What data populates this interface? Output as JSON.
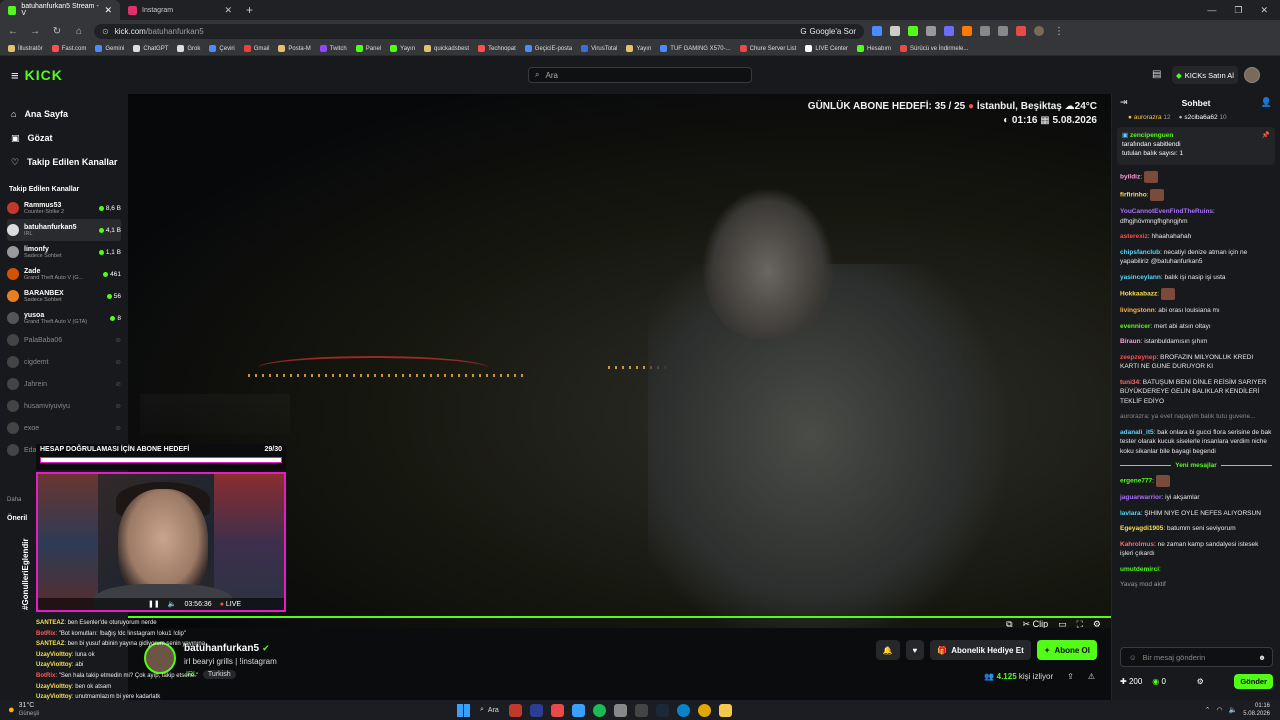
{
  "browser": {
    "tabs": [
      {
        "label": "batuhanfurkan5 Stream - V",
        "active": true,
        "color": "#53fc18"
      },
      {
        "label": "Instagram",
        "active": false,
        "color": "#e1306c"
      }
    ],
    "url_host": "kick.com",
    "url_path": "/batuhanfurkan5",
    "google_sor": "Google'a Sor",
    "bookmarks": [
      "İllustratör",
      "Fast.com",
      "Gemini",
      "ChatGPT",
      "Grok",
      "Çeviri",
      "Gmail",
      "Posta-M",
      "Twitch",
      "Panel",
      "Yayın",
      "quickadsbest",
      "Technopat",
      "GeçiciE-posta",
      "VirusTotal",
      "Yayın",
      "TUF GAMING X570-...",
      "Chure Server List",
      "LIVE Center",
      "Hesabım",
      "Sürücü ve İndirmele..."
    ]
  },
  "header": {
    "logo": "KICK",
    "search_placeholder": "Ara",
    "buy_kicks": "KICKs Satın Al"
  },
  "sidebar": {
    "nav": [
      {
        "label": "Ana Sayfa",
        "icon": "home-icon"
      },
      {
        "label": "Gözat",
        "icon": "browse-icon"
      },
      {
        "label": "Takip Edilen Kanallar",
        "icon": "heart-icon"
      }
    ],
    "section_title": "Takip Edilen Kanallar",
    "channels": [
      {
        "name": "Rammus53",
        "sub": "Counter-Strike 2",
        "viewers": "8,6 B",
        "live": true
      },
      {
        "name": "batuhanfurkan5",
        "sub": "IRL",
        "viewers": "4,1 B",
        "live": true,
        "selected": true
      },
      {
        "name": "limonfy",
        "sub": "Sadece Sohbet",
        "viewers": "1,1 B",
        "live": true
      },
      {
        "name": "Zade",
        "sub": "Grand Theft Auto V (G...",
        "viewers": "461",
        "live": true
      },
      {
        "name": "BARANBEX",
        "sub": "Sadece Sohbet",
        "viewers": "56",
        "live": true
      },
      {
        "name": "yusoa",
        "sub": "Grand Theft Auto V (GTA)",
        "viewers": "8",
        "live": true
      },
      {
        "name": "PalaBaba06",
        "live": false
      },
      {
        "name": "cigdemt",
        "live": false
      },
      {
        "name": "Jahrein",
        "live": false
      },
      {
        "name": "husamviyuviyu",
        "live": false
      },
      {
        "name": "exoe",
        "live": false
      },
      {
        "name": "EdaVera",
        "live": false
      }
    ],
    "more": "Daha",
    "suggested": "Öneril"
  },
  "video": {
    "goal_line1": "GÜNLÜK ABONE HEDEFİ: 35 / 25",
    "location": "İstanbul, Beşiktaş",
    "temp": "24°C",
    "time": "01:16",
    "date": "5.08.2026",
    "sub_goal_title": "HESAP DOĞRULAMASI İÇİN ABONE HEDEFİ",
    "sub_goal_count": "29/30",
    "sub_goal_progress": 0.97,
    "vertical_label": "#GonulleriEglendir",
    "elapsed": "03:56:36",
    "live_label": "LIVE",
    "clip_label": "Clip",
    "progress": 1.0
  },
  "overlay_chat": [
    {
      "user": "SANTEAZ",
      "text": "ben Esenler'de oturuyorum nerde",
      "cls": "u"
    },
    {
      "user": "BotRix",
      "text": "\"Bot komutları: !bağış !dc !instagram !oku1 !clip\"",
      "cls": "u2"
    },
    {
      "user": "SANTEAZ",
      "text": "ben bi yusuf abinin yayına gidiyorum senin yayınına",
      "cls": "u"
    },
    {
      "user": "UzayViolttoy",
      "text": "luna ok",
      "cls": "u"
    },
    {
      "user": "UzayViolttoy",
      "text": "abi",
      "cls": "u"
    },
    {
      "user": "BotRix",
      "text": "\"Sen hala takip etmedin mi? Çok ayıp, takip etsene.\"",
      "cls": "u2"
    },
    {
      "user": "UzayViolttoy",
      "text": "ben ok atsam",
      "cls": "u"
    },
    {
      "user": "UzayViolttoy",
      "text": "unutmamlazım bi yere kadarlatk",
      "cls": "u"
    }
  ],
  "streamer": {
    "name": "batuhanfurkan5",
    "title": "irl bearyi grills | !instagram",
    "tags": [
      "IRL",
      "Turkish"
    ],
    "gift_sub": "Abonelik Hediye Et",
    "subscribe": "Abone Ol",
    "viewers": "4.125",
    "viewers_label": "kişi izliyor"
  },
  "chat": {
    "title": "Sohbet",
    "leaders": [
      {
        "name": "aurorazra",
        "n": "12"
      },
      {
        "name": "s2ciba6a62",
        "n": "10"
      }
    ],
    "pinned_user": "zencipenguen",
    "pinned_by": "tarafından sabitlendi",
    "pinned_text": "tutulan balık sayısı: 1",
    "messages": [
      {
        "user": "byildiz",
        "text": "",
        "color": "#ff9cd6",
        "emote": true
      },
      {
        "user": "firfirinho",
        "text": "",
        "color": "#f4e04d",
        "emote": true
      },
      {
        "user": "YouCannotEvenFindTheRuins",
        "text": "dfhgjhövmngfhghngjhm",
        "color": "#a970ff"
      },
      {
        "user": "asterexiz",
        "text": "hhaahahahah",
        "color": "#ff4d4d"
      },
      {
        "user": "chipsfanclub",
        "text": "necatiyi denize atman için ne yapabiliriz @batuhanfurkan5",
        "color": "#53d8fb"
      },
      {
        "user": "yasinceylann",
        "text": "balık işi nasip işi usta",
        "color": "#53d8fb"
      },
      {
        "user": "Hokkaabazz",
        "text": "",
        "color": "#f4e04d",
        "emote": true
      },
      {
        "user": "livingstonn",
        "text": "abi orası louisiana mı",
        "color": "#ffb347"
      },
      {
        "user": "evennicer",
        "text": "mert abi atsın oltayı",
        "color": "#53fc18"
      },
      {
        "user": "Biraun",
        "text": "istanbuldamısın şıhım",
        "color": "#ff9cd6"
      },
      {
        "user": "zeepzeynep",
        "text": "BROFAZIN MILYONLUK KREDI KARTI NE GUNE DURUYOR KI",
        "color": "#ff4d4d"
      },
      {
        "user": "tuni34",
        "text": "BATUŞUM BENİ DİNLE REİSİM SARIYER BÜYÜKDEREYE GELİN BALIKLAR KENDİLERİ TEKLİF EDİYO",
        "color": "#ff6b6b"
      },
      {
        "user": "adanali_it5",
        "text": "bak onlara bi gucci flora serisine de bak tester olarak kucuk siselerle insanlara verdim niche koku sikanlar bile bayagi begendi",
        "color": "#53d8fb"
      }
    ],
    "reply_preview": "aurorazra: ya evet napayim balık tutu guvene...",
    "new_messages_label": "Yeni mesajlar",
    "messages_after": [
      {
        "user": "ergene777",
        "text": "",
        "color": "#53fc18",
        "emote": true
      },
      {
        "user": "jaguarwarrior",
        "text": "iyi akşamlar",
        "color": "#a970ff"
      },
      {
        "user": "lavlara",
        "text": "ŞIHIM NIYE OYLE NEFES ALIYORSUN",
        "color": "#53d8fb"
      },
      {
        "user": "Egeyagdi1905",
        "text": "batumm seni seviyorum",
        "color": "#f4e04d"
      },
      {
        "user": "Kahrolmus",
        "text": "ne zaman kamp sandalyesi istesek işleri çıkardı",
        "color": "#ff6b6b"
      },
      {
        "user": "umutdemirci",
        "text": "",
        "color": "#53fc18"
      }
    ],
    "slow_mode": "Yavaş mod aktif",
    "input_placeholder": "Bir mesaj gönderin",
    "points": "200",
    "kicks": "0",
    "send": "Gönder"
  },
  "taskbar": {
    "weather": "31°C",
    "weather_sub": "Güneşli",
    "search": "Ara",
    "clock_time": "01:16",
    "clock_date": "5.08.2026"
  }
}
